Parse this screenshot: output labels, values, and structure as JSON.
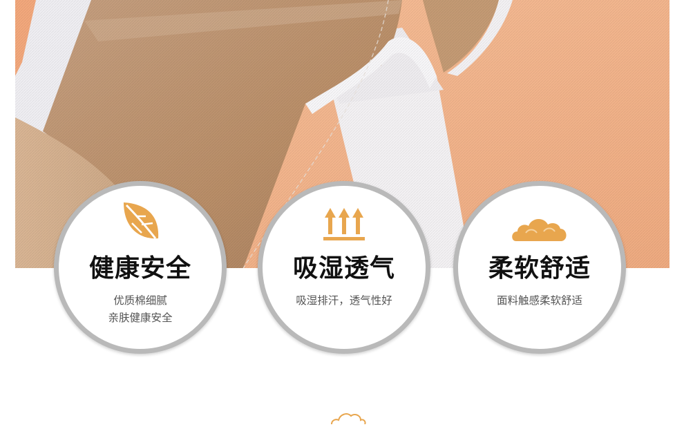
{
  "features": [
    {
      "icon": "leaf-icon",
      "title": "健康安全",
      "lines": [
        "优质棉细腻",
        "亲肤健康安全"
      ]
    },
    {
      "icon": "breathable-arrows-icon",
      "title": "吸湿透气",
      "lines": [
        "吸湿排汗，透气性好"
      ]
    },
    {
      "icon": "cloud-icon",
      "title": "柔软舒适",
      "lines": [
        "面料触感柔软舒适"
      ]
    }
  ],
  "colors": {
    "accent": "#e8a64e",
    "ring": "#b9b9b9",
    "fabric_tan": "#c9a07a",
    "fabric_orange": "#f0b48a",
    "fabric_white": "#f4f2f4"
  },
  "footer": {
    "icon": "cloud-outline-icon"
  }
}
